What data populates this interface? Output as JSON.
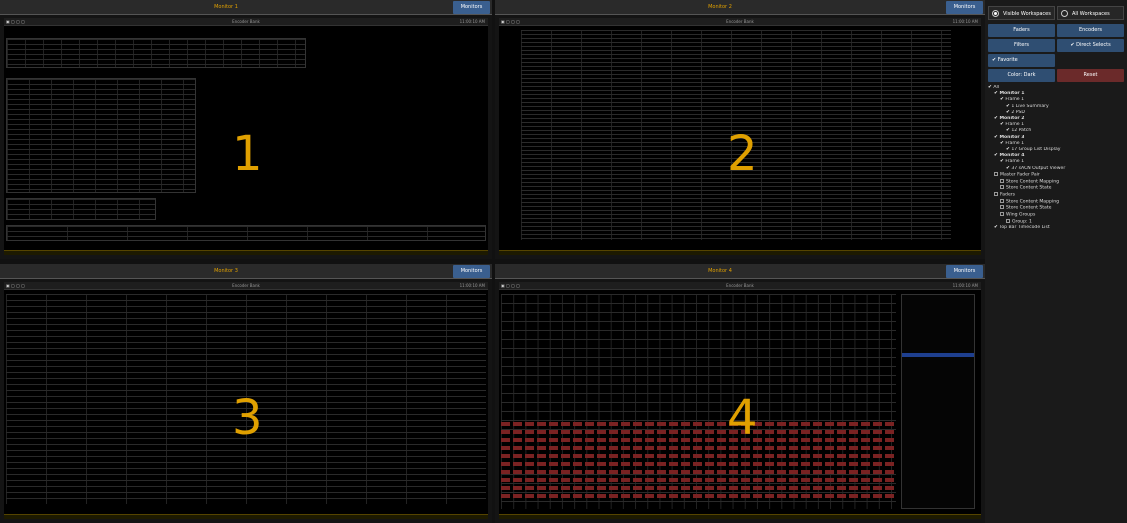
{
  "monitors": [
    {
      "title": "Monitor 1",
      "button": "Monitors",
      "label": "1",
      "toolbar": "Encoder Bank",
      "clock": "11:00:10 AM"
    },
    {
      "title": "Monitor 2",
      "button": "Monitors",
      "label": "2",
      "toolbar": "Encoder Bank",
      "clock": "11:00:10 AM"
    },
    {
      "title": "Monitor 3",
      "button": "Monitors",
      "label": "3",
      "toolbar": "Encoder Bank",
      "clock": "11:00:10 AM"
    },
    {
      "title": "Monitor 4",
      "button": "Monitors",
      "label": "4",
      "toolbar": "Encoder Bank",
      "clock": "11:00:10 AM"
    }
  ],
  "panel": {
    "visible_workspaces": "Visible Workspaces",
    "all_workspaces": "All Workspaces",
    "faders": "Faders",
    "encoders": "Encoders",
    "filters": "Filters",
    "direct_selects": "Direct Selects",
    "favorite": "Favorite",
    "color": "Color: Dark",
    "reset": "Reset",
    "tree": [
      {
        "t": "All",
        "lvl": 0,
        "bold": false,
        "chk": true
      },
      {
        "t": "Monitor 1",
        "lvl": 1,
        "bold": true,
        "chk": true
      },
      {
        "t": "Frame 1",
        "lvl": 2,
        "bold": false,
        "chk": true
      },
      {
        "t": "1 Live Summary",
        "lvl": 3,
        "bold": false,
        "chk": true
      },
      {
        "t": "2 PSD",
        "lvl": 3,
        "bold": false,
        "chk": true
      },
      {
        "t": "Monitor 2",
        "lvl": 1,
        "bold": true,
        "chk": true
      },
      {
        "t": "Frame 1",
        "lvl": 2,
        "bold": false,
        "chk": true
      },
      {
        "t": "12 Patch",
        "lvl": 3,
        "bold": false,
        "chk": true
      },
      {
        "t": "Monitor 3",
        "lvl": 1,
        "bold": true,
        "chk": true
      },
      {
        "t": "Frame 1",
        "lvl": 2,
        "bold": false,
        "chk": true
      },
      {
        "t": "17 Group List Display",
        "lvl": 3,
        "bold": false,
        "chk": true
      },
      {
        "t": "Monitor 4",
        "lvl": 1,
        "bold": true,
        "chk": true
      },
      {
        "t": "Frame 1",
        "lvl": 2,
        "bold": false,
        "chk": true
      },
      {
        "t": "37 sACN Output Viewer",
        "lvl": 3,
        "bold": false,
        "chk": true
      },
      {
        "t": "Master Fader Pair",
        "lvl": 1,
        "bold": false,
        "chk": false
      },
      {
        "t": "Store Content Mapping",
        "lvl": 2,
        "bold": false,
        "chk": false
      },
      {
        "t": "Store Content State",
        "lvl": 2,
        "bold": false,
        "chk": false
      },
      {
        "t": "Faders",
        "lvl": 1,
        "bold": false,
        "chk": false
      },
      {
        "t": "Store Content Mapping",
        "lvl": 2,
        "bold": false,
        "chk": false
      },
      {
        "t": "Store Content State",
        "lvl": 2,
        "bold": false,
        "chk": false
      },
      {
        "t": "Wing Groups",
        "lvl": 2,
        "bold": false,
        "chk": false
      },
      {
        "t": "Group: 1",
        "lvl": 3,
        "bold": false,
        "chk": false
      },
      {
        "t": "Top Bar Timecode List",
        "lvl": 1,
        "bold": false,
        "chk": true
      }
    ]
  }
}
